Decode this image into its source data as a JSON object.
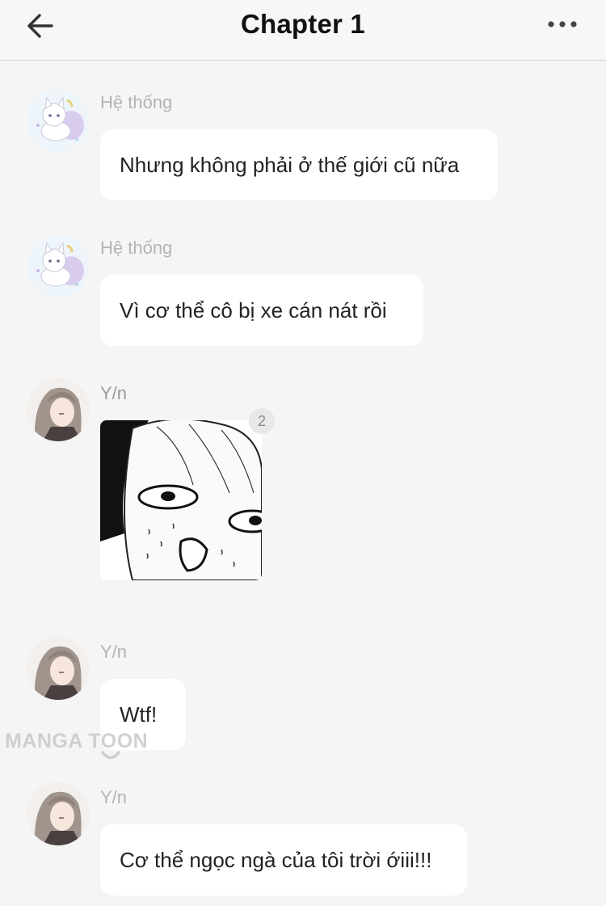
{
  "header": {
    "title": "Chapter 1",
    "back_icon": "arrow-left-icon",
    "more_icon": "more-horizontal-icon"
  },
  "messages": [
    {
      "sender": "Hệ thống",
      "avatar": "cat-avatar",
      "type": "text",
      "text": "Nhưng không phải ở thế giới cũ nữa"
    },
    {
      "sender": "Hệ thống",
      "avatar": "cat-avatar",
      "type": "text",
      "text": "Vì cơ thể cô bị xe cán nát rồi"
    },
    {
      "sender": "Y/n",
      "avatar": "girl-avatar",
      "type": "image",
      "badge": "2"
    },
    {
      "sender": "Y/n",
      "avatar": "girl-avatar",
      "type": "text",
      "text": "Wtf!"
    },
    {
      "sender": "Y/n",
      "avatar": "girl-avatar",
      "type": "text",
      "text": "Cơ thể ngọc ngà của tôi trời ớiii!!!"
    }
  ],
  "watermark": {
    "text": "MANGA TOON"
  },
  "colors": {
    "background": "#f5f5f5",
    "bubble": "#ffffff",
    "sender_name": "#b4b4b4",
    "text": "#222222"
  }
}
